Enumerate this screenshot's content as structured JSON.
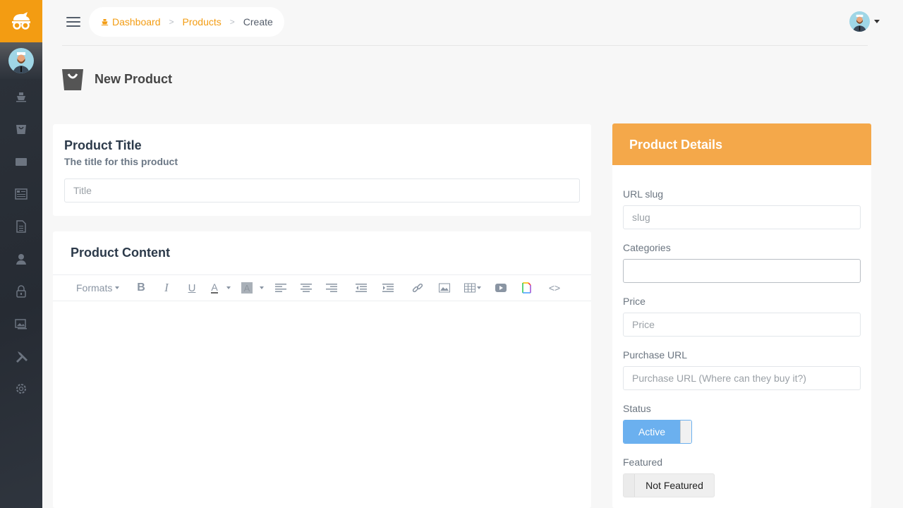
{
  "sidebar": {
    "brand_color": "#f39c12",
    "items": [
      {
        "name": "dashboard",
        "icon": "ship-icon"
      },
      {
        "name": "products",
        "icon": "shopping-bag-icon"
      },
      {
        "name": "categories",
        "icon": "folder-icon"
      },
      {
        "name": "posts",
        "icon": "newspaper-icon"
      },
      {
        "name": "pages",
        "icon": "document-icon"
      },
      {
        "name": "users",
        "icon": "person-icon"
      },
      {
        "name": "roles",
        "icon": "lock-icon"
      },
      {
        "name": "media",
        "icon": "images-icon"
      },
      {
        "name": "tools",
        "icon": "tools-icon"
      },
      {
        "name": "settings",
        "icon": "gear-icon"
      }
    ]
  },
  "breadcrumb": {
    "items": [
      {
        "label": "Dashboard"
      },
      {
        "label": "Products"
      },
      {
        "label": "Create"
      }
    ],
    "separator": ">"
  },
  "page": {
    "title": "New Product"
  },
  "title_card": {
    "heading": "Product Title",
    "subheading": "The title for this product",
    "input_placeholder": "Title",
    "input_value": ""
  },
  "content_card": {
    "heading": "Product Content",
    "toolbar": {
      "formats_label": "Formats"
    }
  },
  "details": {
    "header": "Product Details",
    "header_color": "#f4a84a",
    "slug": {
      "label": "URL slug",
      "placeholder": "slug",
      "value": ""
    },
    "categories": {
      "label": "Categories",
      "value": ""
    },
    "price": {
      "label": "Price",
      "placeholder": "Price",
      "value": ""
    },
    "purchase_url": {
      "label": "Purchase URL",
      "placeholder": "Purchase URL (Where can they buy it?)",
      "value": ""
    },
    "status": {
      "label": "Status",
      "value": "Active",
      "on": true
    },
    "featured": {
      "label": "Featured",
      "value": "Not Featured",
      "on": false
    }
  }
}
